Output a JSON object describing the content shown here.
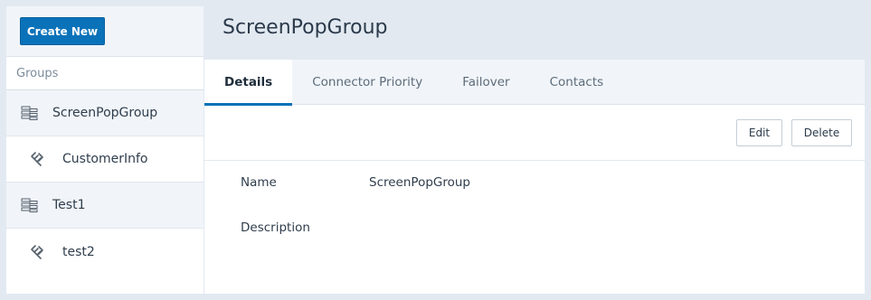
{
  "sidebar": {
    "create_button": "Create New",
    "groups_header": "Groups",
    "items": [
      {
        "label": "ScreenPopGroup",
        "type": "group",
        "icon": "server-group-icon"
      },
      {
        "label": "CustomerInfo",
        "type": "connector",
        "icon": "connector-link-icon"
      },
      {
        "label": "Test1",
        "type": "group",
        "icon": "server-group-icon"
      },
      {
        "label": "test2",
        "type": "connector",
        "icon": "connector-link-icon"
      }
    ]
  },
  "main": {
    "title": "ScreenPopGroup",
    "tabs": [
      {
        "label": "Details",
        "active": true
      },
      {
        "label": "Connector Priority",
        "active": false
      },
      {
        "label": "Failover",
        "active": false
      },
      {
        "label": "Contacts",
        "active": false
      }
    ],
    "actions": {
      "edit": "Edit",
      "delete": "Delete"
    },
    "fields": {
      "name_label": "Name",
      "name_value": "ScreenPopGroup",
      "description_label": "Description",
      "description_value": ""
    }
  },
  "colors": {
    "accent": "#0a72b9",
    "background": "#e2e9f1",
    "panel_header": "#f1f5f9"
  }
}
